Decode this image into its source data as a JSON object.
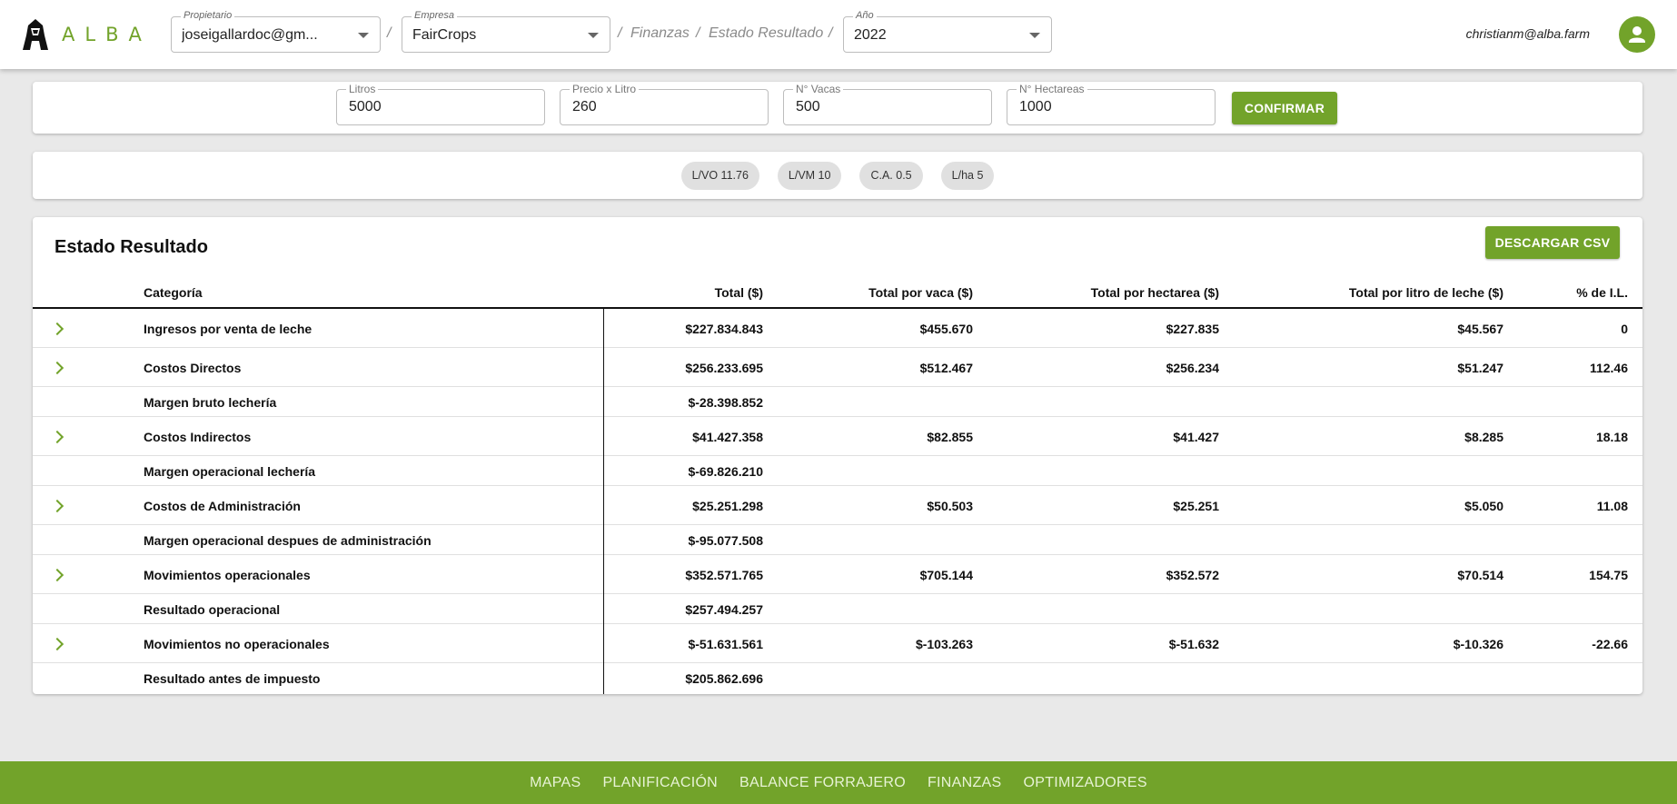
{
  "header": {
    "brand": "ALBA",
    "owner": {
      "label": "Propietario",
      "value": "joseigallardoc@gm..."
    },
    "company": {
      "label": "Empresa",
      "value": "FairCrops"
    },
    "sep1": "/",
    "sep2": "/",
    "sep3": "/",
    "sep4": "/",
    "crumb_finance": "Finanzas",
    "crumb_statement": "Estado Resultado",
    "year": {
      "label": "Año",
      "value": "2022"
    },
    "user_email": "christianm@alba.farm"
  },
  "inputs": {
    "liters": {
      "label": "Litros",
      "value": "5000"
    },
    "price": {
      "label": "Precio x Litro",
      "value": "260"
    },
    "cows": {
      "label": "N° Vacas",
      "value": "500"
    },
    "hectares": {
      "label": "N° Hectareas",
      "value": "1000"
    },
    "confirm_label": "CONFIRMAR"
  },
  "chips": [
    "L/VO 11.76",
    "L/VM 10",
    "C.A. 0.5",
    "L/ha 5"
  ],
  "table": {
    "title": "Estado Resultado",
    "csv_label": "DESCARGAR CSV",
    "headers": [
      "Categoría",
      "Total ($)",
      "Total por vaca ($)",
      "Total por hectarea ($)",
      "Total por litro de leche ($)",
      "% de I.L."
    ],
    "rows": [
      {
        "cat": "Ingresos por venta de leche",
        "total": "$227.834.843",
        "vaca": "$455.670",
        "ha": "$227.835",
        "litro": "$45.567",
        "pct": "0"
      },
      {
        "cat": "Costos Directos",
        "total": "$256.233.695",
        "vaca": "$512.467",
        "ha": "$256.234",
        "litro": "$51.247",
        "pct": "112.46"
      },
      {
        "cat": "Margen bruto lechería",
        "total": "$-28.398.852"
      },
      {
        "cat": "Costos Indirectos",
        "total": "$41.427.358",
        "vaca": "$82.855",
        "ha": "$41.427",
        "litro": "$8.285",
        "pct": "18.18"
      },
      {
        "cat": "Margen operacional lechería",
        "total": "$-69.826.210"
      },
      {
        "cat": "Costos de Administración",
        "total": "$25.251.298",
        "vaca": "$50.503",
        "ha": "$25.251",
        "litro": "$5.050",
        "pct": "11.08"
      },
      {
        "cat": "Margen operacional despues de administración",
        "total": "$-95.077.508"
      },
      {
        "cat": "Movimientos operacionales",
        "total": "$352.571.765",
        "vaca": "$705.144",
        "ha": "$352.572",
        "litro": "$70.514",
        "pct": "154.75"
      },
      {
        "cat": "Resultado operacional",
        "total": "$257.494.257"
      },
      {
        "cat": "Movimientos no operacionales",
        "total": "$-51.631.561",
        "vaca": "$-103.263",
        "ha": "$-51.632",
        "litro": "$-10.326",
        "pct": "-22.66"
      },
      {
        "cat": "Resultado antes de impuesto",
        "total": "$205.862.696"
      }
    ]
  },
  "footer_nav": [
    "MAPAS",
    "PLANIFICACIÓN",
    "BALANCE FORRAJERO",
    "FINANZAS",
    "OPTIMIZADORES"
  ],
  "colors": {
    "accent": "#72a32a"
  }
}
